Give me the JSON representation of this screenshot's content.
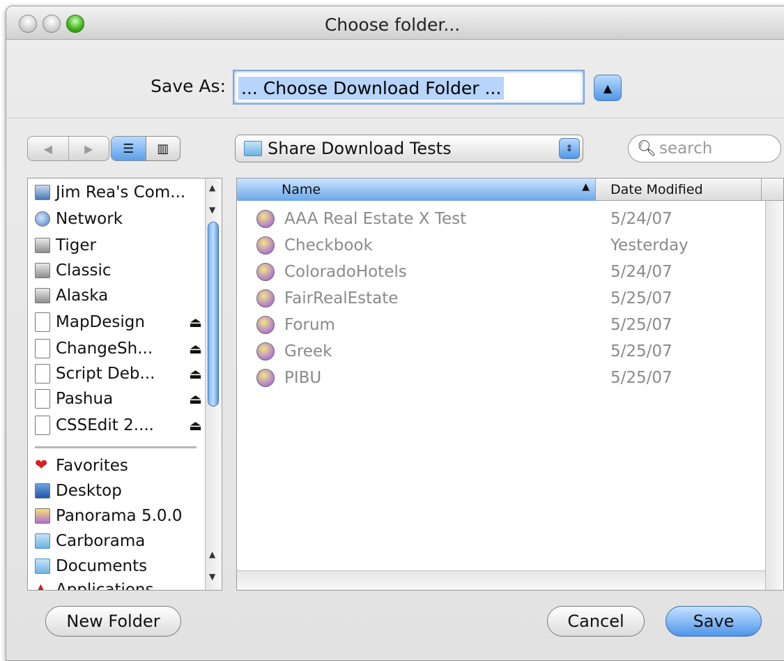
{
  "window": {
    "title": "Choose folder..."
  },
  "save_as": {
    "label": "Save As:",
    "value": "... Choose Download Folder ..."
  },
  "location_popup": {
    "label": "Share Download Tests"
  },
  "search": {
    "placeholder": "search"
  },
  "sidebar": {
    "devices": [
      {
        "label": "Jim Rea's Com...",
        "icon": "computer-icon",
        "eject": false
      },
      {
        "label": "Network",
        "icon": "network-icon",
        "eject": false
      },
      {
        "label": "Tiger",
        "icon": "disk-icon",
        "eject": false
      },
      {
        "label": "Classic",
        "icon": "disk-icon",
        "eject": false
      },
      {
        "label": "Alaska",
        "icon": "disk-icon",
        "eject": false
      },
      {
        "label": "MapDesign",
        "icon": "volume-icon",
        "eject": true
      },
      {
        "label": "ChangeSh...",
        "icon": "volume-icon",
        "eject": true
      },
      {
        "label": "Script Deb...",
        "icon": "volume-icon",
        "eject": true
      },
      {
        "label": "Pashua",
        "icon": "volume-icon",
        "eject": true
      },
      {
        "label": "CSSEdit 2....",
        "icon": "volume-icon",
        "eject": true
      }
    ],
    "places": [
      {
        "label": "Favorites",
        "icon": "heart-icon"
      },
      {
        "label": "Desktop",
        "icon": "desktop-icon"
      },
      {
        "label": "Panorama 5.0.0",
        "icon": "panorama-icon"
      },
      {
        "label": "Carborama",
        "icon": "folder-icon"
      },
      {
        "label": "Documents",
        "icon": "folder-icon"
      },
      {
        "label": "Applications",
        "icon": "applications-icon"
      }
    ]
  },
  "file_list": {
    "columns": {
      "name": "Name",
      "date": "Date Modified"
    },
    "rows": [
      {
        "name": "AAA Real Estate X Test",
        "date": "5/24/07"
      },
      {
        "name": "Checkbook",
        "date": "Yesterday"
      },
      {
        "name": "ColoradoHotels",
        "date": "5/24/07"
      },
      {
        "name": "FairRealEstate",
        "date": "5/25/07"
      },
      {
        "name": "Forum",
        "date": "5/25/07"
      },
      {
        "name": "Greek",
        "date": "5/25/07"
      },
      {
        "name": "PIBU",
        "date": "5/25/07"
      }
    ]
  },
  "buttons": {
    "new_folder": "New Folder",
    "cancel": "Cancel",
    "save": "Save"
  },
  "colors": {
    "accent": "#4c95ea",
    "selection": "#b7d4fa"
  }
}
